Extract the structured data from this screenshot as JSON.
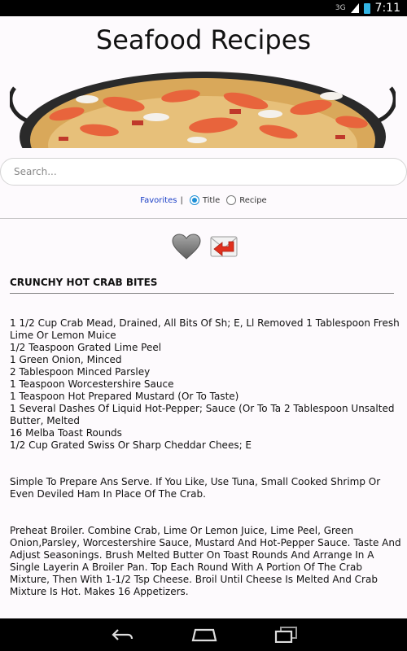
{
  "status_bar": {
    "network": "3G",
    "time": "7:11"
  },
  "app": {
    "title": "Seafood Recipes"
  },
  "search": {
    "placeholder": "Search..."
  },
  "filter": {
    "favorites_label": "Favorites",
    "separator": "|",
    "options": [
      "Title",
      "Recipe"
    ],
    "selected": "Title"
  },
  "recipe": {
    "title": "CRUNCHY HOT CRAB BITES",
    "ingredients": [
      "1 1/2 Cup Crab Mead, Drained, All Bits Of Sh; E, Ll Removed 1 Tablespoon Fresh Lime Or Lemon Muice",
      "1/2 Teaspoon Grated Lime Peel",
      "1 Green Onion, Minced",
      "2 Tablespoon Minced Parsley",
      "1 Teaspoon Worcestershire Sauce",
      "1 Teaspoon Hot Prepared Mustard (Or To Taste)",
      "1 Several Dashes Of Liquid Hot-Pepper; Sauce (Or To Ta 2 Tablespoon Unsalted Butter, Melted",
      "16 Melba Toast Rounds",
      "1/2 Cup Grated Swiss Or Sharp Cheddar Chees; E"
    ],
    "note": "Simple To Prepare Ans Serve. If You Like, Use Tuna, Small Cooked Shrimp Or Even Deviled Ham In Place Of The Crab.",
    "directions": "Preheat Broiler. Combine Crab, Lime Or Lemon Juice, Lime Peel, Green Onion,Parsley, Worcestershire Sauce, Mustard And Hot-Pepper Sauce. Taste And Adjust Seasonings. Brush Melted Butter On Toast Rounds And Arrange In A Single Layerin A Broiler Pan. Top Each Round With A Portion Of The Crab Mixture, Then With 1-1/2 Tsp Cheese. Broil Until Cheese Is Melted And Crab Mixture Is Hot. Makes 16 Appetizers."
  },
  "colors": {
    "accent": "#1e8fd6",
    "link": "#1a3fc6",
    "bar": "#000000",
    "battery": "#33b5e5"
  },
  "icons": {
    "favorite": "heart-icon",
    "share": "envelope-reply-icon",
    "back": "back-icon",
    "home": "home-icon",
    "recents": "recents-icon"
  }
}
